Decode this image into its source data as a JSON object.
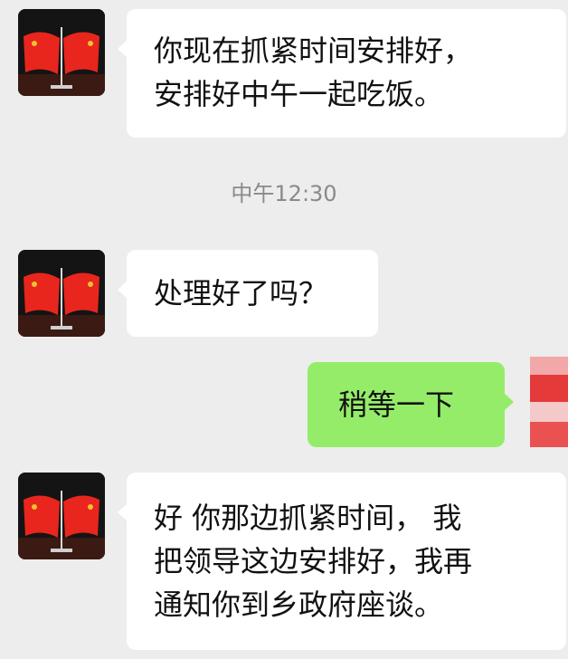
{
  "messages": [
    {
      "side": "left",
      "lines": [
        "你现在抓紧时间安排好，",
        "安排好中午一起吃饭。"
      ]
    },
    {
      "side": "left",
      "lines": [
        "处理好了吗？"
      ]
    },
    {
      "side": "right",
      "lines": [
        "稍等一下"
      ]
    },
    {
      "side": "left",
      "lines": [
        "好 你那边抓紧时间， 我",
        "把领导这边安排好，我再",
        "通知你到乡政府座谈。"
      ]
    }
  ],
  "timestamp": "中午12:30",
  "colors": {
    "background": "#ededed",
    "incoming_bubble": "#ffffff",
    "outgoing_bubble": "#95ec69",
    "timestamp_text": "#8a8a8a",
    "flag_red": "#e8261d",
    "emblem_gold": "#f2c12e"
  },
  "icons": {
    "contact_avatar": "flag-avatar-icon",
    "self_avatar": "blurred-avatar-icon"
  }
}
